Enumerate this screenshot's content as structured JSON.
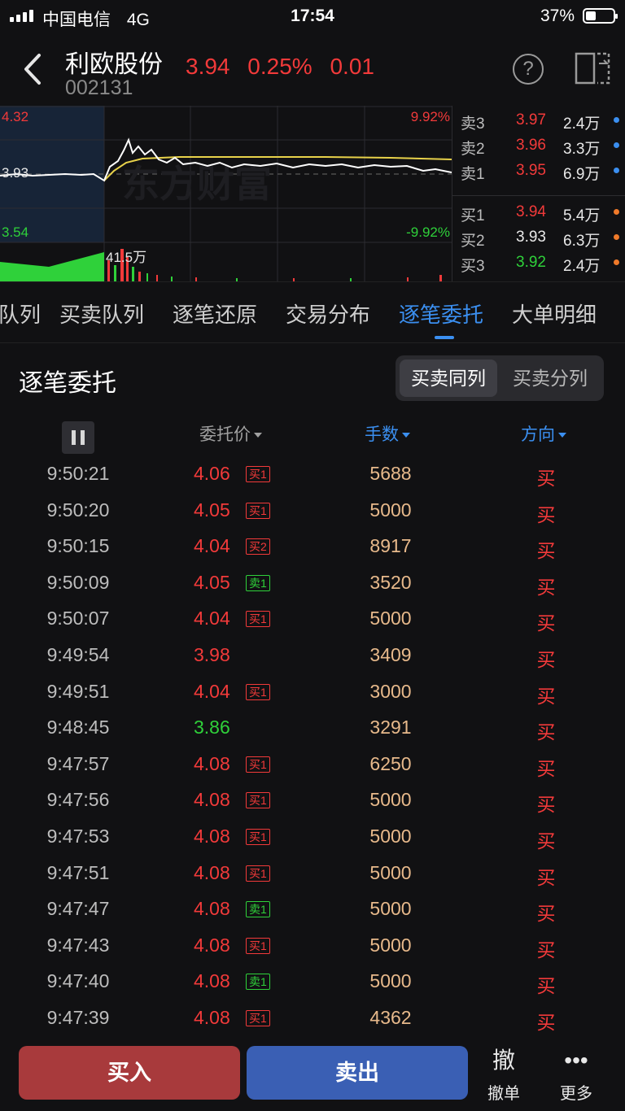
{
  "status_bar": {
    "carrier": "中国电信",
    "network": "4G",
    "time": "17:54",
    "battery": "37%"
  },
  "stock": {
    "name": "利欧股份",
    "code": "002131",
    "price": "3.94",
    "change_pct": "0.25%",
    "change": "0.01"
  },
  "chart": {
    "high_label": "4.32",
    "base_label": "3.93",
    "low_label": "3.54",
    "up_pct_label": "9.92%",
    "down_pct_label": "-9.92%",
    "volume_label": "41.5万",
    "watermark": "东方财富"
  },
  "order_book": {
    "asks": [
      {
        "name": "卖3",
        "price": "3.97",
        "volume": "2.4万"
      },
      {
        "name": "卖2",
        "price": "3.96",
        "volume": "3.3万"
      },
      {
        "name": "卖1",
        "price": "3.95",
        "volume": "6.9万"
      }
    ],
    "bids": [
      {
        "name": "买1",
        "price": "3.94",
        "volume": "5.4万"
      },
      {
        "name": "买2",
        "price": "3.93",
        "volume": "6.3万"
      },
      {
        "name": "买3",
        "price": "3.92",
        "volume": "2.4万"
      }
    ],
    "colors": {
      "ask_dot": "#3b8ff0",
      "bid_dot": "#f07a2a",
      "up": "#f23a3a",
      "down": "#2fd13a"
    }
  },
  "tabs": [
    "队列",
    "买卖队列",
    "逐笔还原",
    "交易分布",
    "逐笔委托",
    "大单明细"
  ],
  "active_tab": "逐笔委托",
  "section": {
    "title": "逐笔委托",
    "toggle_on": "买卖同列",
    "toggle_off": "买卖分列"
  },
  "columns": {
    "price": "委托价",
    "qty": "手数",
    "dir": "方向"
  },
  "rows": [
    {
      "time": "9:50:21",
      "price": "4.06",
      "badge": "买1",
      "qty": "5688",
      "dir": "买"
    },
    {
      "time": "9:50:20",
      "price": "4.05",
      "badge": "买1",
      "qty": "5000",
      "dir": "买"
    },
    {
      "time": "9:50:15",
      "price": "4.04",
      "badge": "买2",
      "qty": "8917",
      "dir": "买"
    },
    {
      "time": "9:50:09",
      "price": "4.05",
      "badge": "卖1",
      "qty": "3520",
      "dir": "买"
    },
    {
      "time": "9:50:07",
      "price": "4.04",
      "badge": "买1",
      "qty": "5000",
      "dir": "买"
    },
    {
      "time": "9:49:54",
      "price": "3.98",
      "badge": "",
      "qty": "3409",
      "dir": "买"
    },
    {
      "time": "9:49:51",
      "price": "4.04",
      "badge": "买1",
      "qty": "3000",
      "dir": "买"
    },
    {
      "time": "9:48:45",
      "price": "3.86",
      "badge": "",
      "qty": "3291",
      "dir": "买"
    },
    {
      "time": "9:47:57",
      "price": "4.08",
      "badge": "买1",
      "qty": "6250",
      "dir": "买"
    },
    {
      "time": "9:47:56",
      "price": "4.08",
      "badge": "买1",
      "qty": "5000",
      "dir": "买"
    },
    {
      "time": "9:47:53",
      "price": "4.08",
      "badge": "买1",
      "qty": "5000",
      "dir": "买"
    },
    {
      "time": "9:47:51",
      "price": "4.08",
      "badge": "买1",
      "qty": "5000",
      "dir": "买"
    },
    {
      "time": "9:47:47",
      "price": "4.08",
      "badge": "卖1",
      "qty": "5000",
      "dir": "买"
    },
    {
      "time": "9:47:43",
      "price": "4.08",
      "badge": "买1",
      "qty": "5000",
      "dir": "买"
    },
    {
      "time": "9:47:40",
      "price": "4.08",
      "badge": "卖1",
      "qty": "5000",
      "dir": "买"
    },
    {
      "time": "9:47:39",
      "price": "4.08",
      "badge": "买1",
      "qty": "4362",
      "dir": "买"
    }
  ],
  "bottom": {
    "buy": "买入",
    "sell": "卖出",
    "cancel_icon": "撤",
    "cancel": "撤单",
    "more_icon": "•••",
    "more": "更多"
  }
}
